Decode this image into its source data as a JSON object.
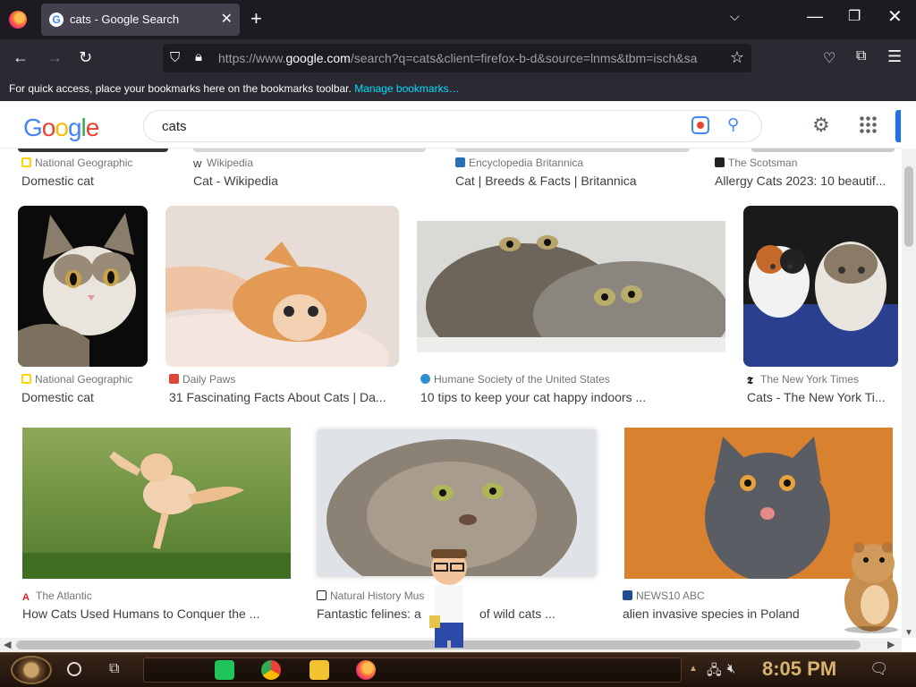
{
  "browser": {
    "tab": {
      "title": "cats - Google Search",
      "favicon": "G"
    },
    "url": {
      "host_prefix": "https://www.",
      "host": "google.com",
      "path": "/search?q=cats&client=firefox-b-d&source=lnms&tbm=isch&sa"
    },
    "bookmarks_bar": {
      "message": "For quick access, place your bookmarks here on the bookmarks toolbar.",
      "link": "Manage bookmarks…"
    }
  },
  "google": {
    "logo": [
      "G",
      "o",
      "o",
      "g",
      "l",
      "e"
    ],
    "logo_colors": [
      "#4285f4",
      "#ea4335",
      "#fbbc05",
      "#4285f4",
      "#34a853",
      "#ea4335"
    ],
    "query": "cats"
  },
  "results": {
    "row1": [
      {
        "source": "National Geographic",
        "title": "Domestic cat",
        "fav_color": "#ffd400"
      },
      {
        "source": "Wikipedia",
        "title": "Cat - Wikipedia",
        "fav_color": "#ffffff"
      },
      {
        "source": "Encyclopedia Britannica",
        "title": "Cat | Breeds & Facts | Britannica",
        "fav_color": "#2a6fb6"
      },
      {
        "source": "The Scotsman",
        "title": "Allergy Cats 2023: 10 beautif...",
        "fav_color": "#222222"
      }
    ],
    "row2": [
      {
        "source": "National Geographic",
        "title": "Domestic cat",
        "fav_color": "#ffd400"
      },
      {
        "source": "Daily Paws",
        "title": "31 Fascinating Facts About Cats | Da...",
        "fav_color": "#e0453a"
      },
      {
        "source": "Humane Society of the United States",
        "title": "10 tips to keep your cat happy indoors ...",
        "fav_color": "#2f8fd1"
      },
      {
        "source": "The New York Times",
        "title": "Cats - The New York Ti...",
        "fav_color": "#111111"
      }
    ],
    "row3": [
      {
        "source": "The Atlantic",
        "title": "How Cats Used Humans to Conquer the ...",
        "fav_color": "#e41b23"
      },
      {
        "source": "Natural History Mus",
        "title": "Fantastic felines: a",
        "title_tail": "of wild cats ...",
        "fav_color": "#222222"
      },
      {
        "source": "NEWS10 ABC",
        "title": "alien invasive species in Poland",
        "fav_color": "#1d4e91"
      }
    ]
  },
  "taskbar": {
    "clock": "8:05 PM"
  },
  "icons": {
    "tab_close": "close-icon",
    "new_tab": "plus-icon",
    "back": "back-arrow-icon",
    "forward": "forward-arrow-icon",
    "reload": "reload-icon",
    "shield": "shield-icon",
    "lock": "lock-icon",
    "star": "star-icon",
    "settings": "gear-icon",
    "apps": "grid-icon"
  },
  "colors": {
    "firefox_dark": "#1c1b22",
    "toolbar": "#2b2a33",
    "link_cyan": "#00ddff",
    "google_blue": "#1a73e8"
  }
}
